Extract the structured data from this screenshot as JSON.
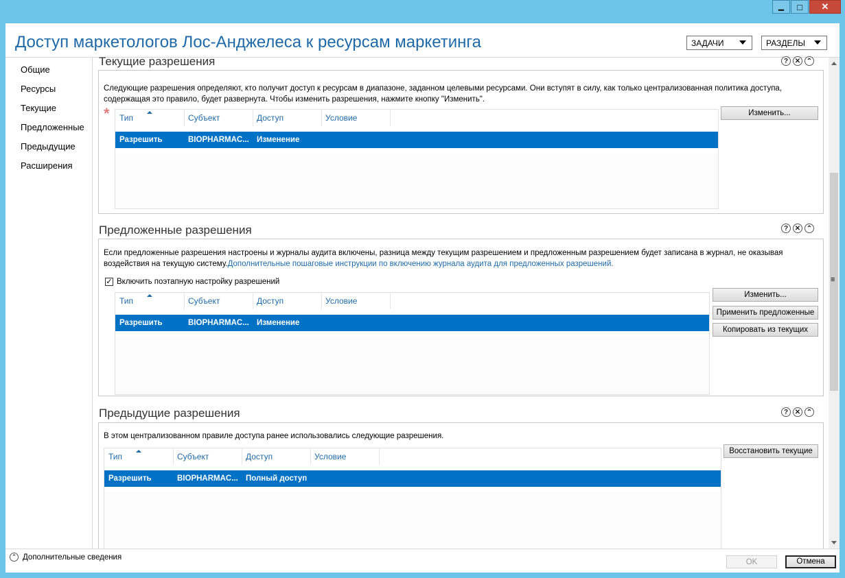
{
  "window": {
    "minimize_symbol": "▁",
    "maximize_symbol": "□",
    "close_symbol": "✕"
  },
  "header": {
    "title": "Доступ маркетологов Лос-Анджелеса к ресурсам маркетинга",
    "tasks_label": "ЗАДАЧИ",
    "sections_label": "РАЗДЕЛЫ"
  },
  "nav": {
    "items": [
      "Общие",
      "Ресурсы",
      "Текущие",
      "Предложенные",
      "Предыдущие",
      "Расширения"
    ]
  },
  "columns": [
    "Тип",
    "Субъект",
    "Доступ",
    "Условие"
  ],
  "icons": {
    "help": "?",
    "close": "✕",
    "collapse": "⌃"
  },
  "current": {
    "title": "Текущие разрешения",
    "description": "Следующие разрешения определяют, кто получит доступ к ресурсам в диапазоне, заданном целевыми ресурсами. Они вступят в силу, как только централизованная политика доступа, содержащая это правило, будет развернута. Чтобы изменить разрешения, нажмите кнопку \"Изменить\".",
    "required_mark": "*",
    "row": {
      "type": "Разрешить",
      "subject": "BIOPHARMAC...",
      "access": "Изменение",
      "condition": ""
    },
    "edit_button": "Изменить..."
  },
  "proposed": {
    "title": "Предложенные разрешения",
    "description": "Если предложенные разрешения настроены и журналы аудита включены, разница между текущим разрешением и предложенным разрешением будет записана в журнал, не оказывая воздействия на текущую систему.",
    "link": "Дополнительные пошаговые инструкции по включению журнала аудита для предложенных разрешений.",
    "checkbox_label": "Включить поэтапную настройку разрешений",
    "checkbox_mark": "✓",
    "row": {
      "type": "Разрешить",
      "subject": "BIOPHARMAC...",
      "access": "Изменение",
      "condition": ""
    },
    "edit_button": "Изменить...",
    "apply_button": "Применить предложенные",
    "copy_button": "Копировать из текущих"
  },
  "previous": {
    "title": "Предыдущие разрешения",
    "description": "В этом централизованном правиле доступа ранее использовались следующие разрешения.",
    "row": {
      "type": "Разрешить",
      "subject": "BIOPHARMAC...",
      "access": "Полный доступ",
      "condition": ""
    },
    "restore_button": "Восстановить текущие"
  },
  "footer": {
    "more_info": "Дополнительные сведения",
    "more_icon": "⌃",
    "ok_label": "OK",
    "cancel_label": "Отмена"
  },
  "scrollbar": {
    "grip": "≡"
  }
}
